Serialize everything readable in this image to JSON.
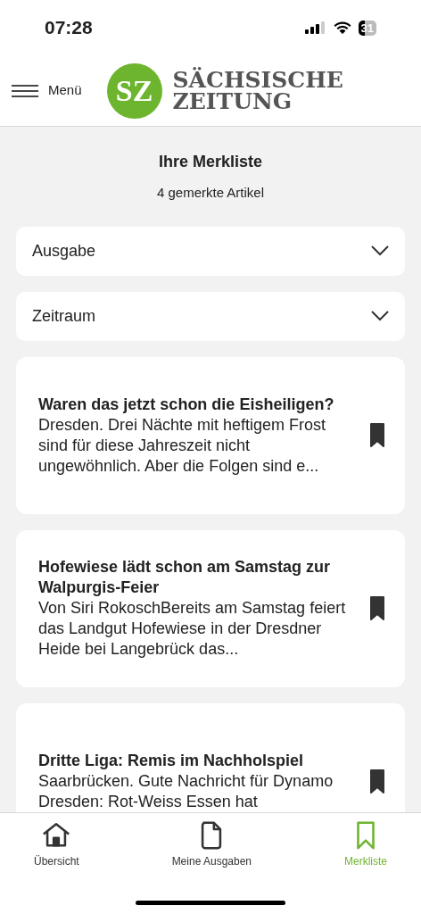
{
  "status_bar": {
    "time": "07:28",
    "battery": "31"
  },
  "header": {
    "menu_label": "Menü",
    "logo_mark": "SZ",
    "logo_line_1": "SÄCHSISCHE",
    "logo_line_2": "ZEITUNG"
  },
  "list_header": {
    "title": "Ihre Merkliste",
    "count": "4 gemerkte Artikel"
  },
  "filters": [
    {
      "label": "Ausgabe",
      "expanded": false
    },
    {
      "label": "Zeitraum",
      "expanded": false
    }
  ],
  "articles": [
    {
      "title": "Waren das jetzt schon die Eisheiligen?",
      "excerpt": "Dresden. Drei Nächte mit heftigem Frost sind für diese Jahreszeit nicht ungewöhnlich. Aber die Folgen sind e...",
      "bookmarked": true
    },
    {
      "title": "Hofewiese lädt schon am Samstag zur Walpurgis-Feier",
      "excerpt": "Von Siri RokoschBereits am Samstag feiert das Landgut Hofewiese in der Dresdner Heide bei Langebrück das...",
      "bookmarked": true
    },
    {
      "title": "Dritte Liga: Remis im Nachholspiel",
      "excerpt": "Saarbrücken. Gute Nachricht für Dynamo Dresden: Rot-Weiss Essen hat",
      "bookmarked": true
    }
  ],
  "tab_bar": [
    {
      "kind": "home",
      "label": "Übersicht",
      "selected": false
    },
    {
      "kind": "document",
      "label": "Meine Ausgaben",
      "selected": false
    },
    {
      "kind": "bookmark",
      "label": "Merkliste",
      "selected": true
    }
  ]
}
